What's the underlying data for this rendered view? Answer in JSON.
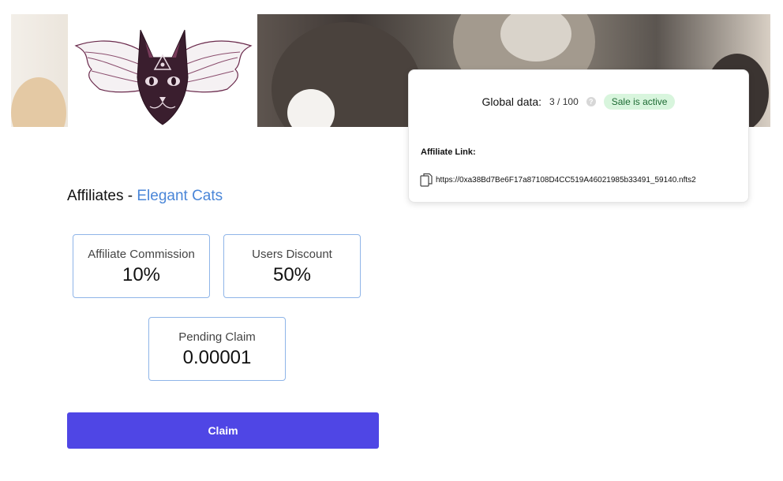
{
  "banner": {
    "logo_icon": "winged-cat-logo-icon"
  },
  "card": {
    "global_label": "Global data:",
    "global_count": "3 / 100",
    "help_icon": "question-icon",
    "status": "Sale is active",
    "affiliate_link_label": "Affiliate Link:",
    "copy_icon": "copy-icon",
    "affiliate_url": "https://0xa38Bd7Be6F17a87108D4CC519A46021985b33491_59140.nfts2"
  },
  "section": {
    "title_prefix": "Affiliates - ",
    "title_brand": "Elegant Cats"
  },
  "stats": {
    "commission": {
      "label": "Affiliate Commission",
      "value": "10%"
    },
    "discount": {
      "label": "Users Discount",
      "value": "50%"
    },
    "pending": {
      "label": "Pending Claim",
      "value": "0.00001"
    }
  },
  "claim_button": "Claim",
  "colors": {
    "accent": "#4f46e5",
    "link": "#4a86d8",
    "badge_bg": "#d8f5dd",
    "stat_border": "#8fb5e8"
  }
}
